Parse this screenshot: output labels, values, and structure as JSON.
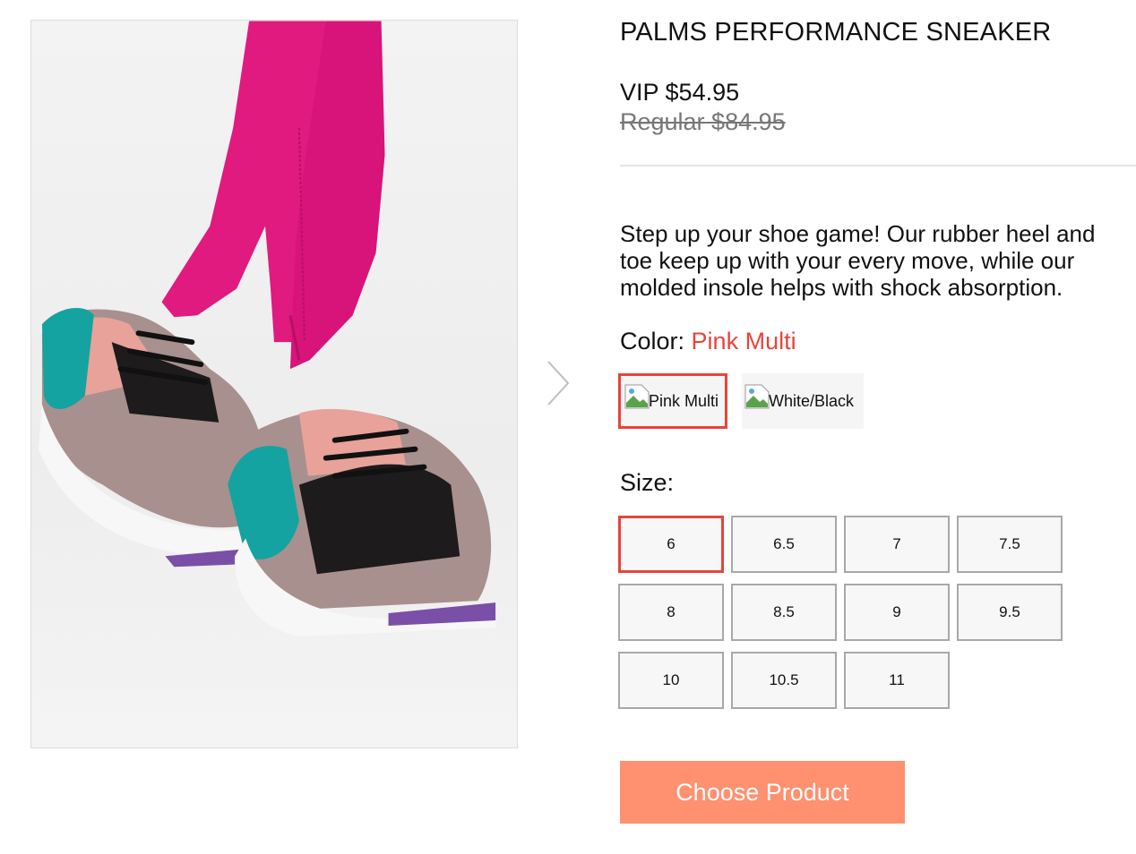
{
  "product": {
    "title": "PALMS PERFORMANCE SNEAKER",
    "price_vip": "VIP $54.95",
    "price_regular": "Regular $84.95",
    "description": "Step up your shoe game! Our rubber heel and toe keep up with your every move, while our molded insole helps with shock absorption."
  },
  "color": {
    "label": "Color:",
    "selected": "Pink Multi",
    "swatches": [
      {
        "alt": "Pink Multi",
        "selected": true
      },
      {
        "alt": "White/Black",
        "selected": false
      }
    ]
  },
  "size": {
    "label": "Size:",
    "options": [
      "6",
      "6.5",
      "7",
      "7.5",
      "8",
      "8.5",
      "9",
      "9.5",
      "10",
      "10.5",
      "11"
    ],
    "selected": "6"
  },
  "cta": {
    "label": "Choose Product"
  },
  "colors": {
    "accent": "#e8443a",
    "button": "#ff9070",
    "leggings": "#e01a7e",
    "teal": "#14a3a0"
  },
  "icons": {
    "next": "chevron-right-icon",
    "broken_image": "broken-image-icon"
  }
}
